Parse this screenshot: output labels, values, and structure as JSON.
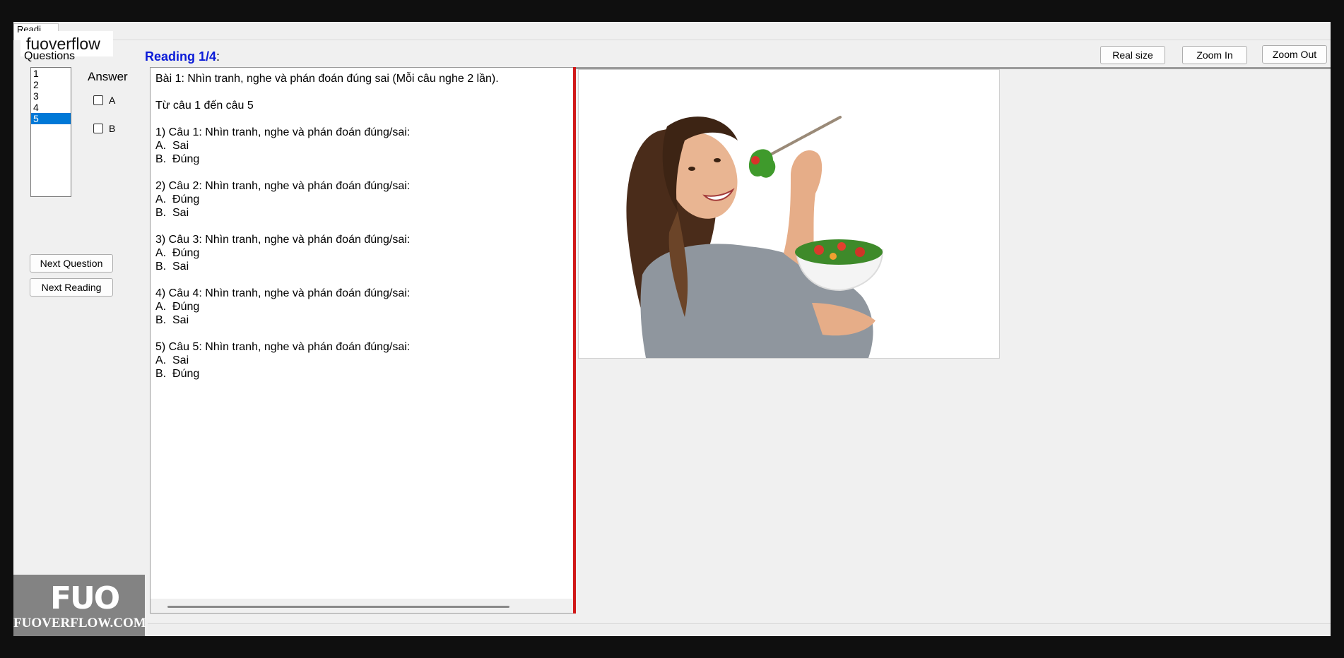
{
  "watermark": {
    "top_text": "fuoverflow",
    "logo_mark": "FUO",
    "logo_site": "FUOVERFLOW.COM"
  },
  "tab": {
    "label": "Readi..."
  },
  "sidebar": {
    "questions_label": "Questions",
    "question_items": [
      "1",
      "2",
      "3",
      "4",
      "5"
    ],
    "selected_question": "5",
    "answer_label": "Answer",
    "answer_options": [
      "A",
      "B"
    ],
    "next_question_label": "Next Question",
    "next_reading_label": "Next Reading"
  },
  "reading": {
    "title": "Reading 1/4",
    "title_suffix": ":",
    "text_lines": [
      "Bài 1: Nhìn tranh, nghe và phán đoán đúng sai (Mỗi câu nghe 2 lần).",
      "",
      "Từ câu 1 đến câu 5",
      "",
      "1) Câu 1: Nhìn tranh, nghe và phán đoán đúng/sai:",
      "A.  Sai",
      "B.  Đúng",
      "",
      "2) Câu 2: Nhìn tranh, nghe và phán đoán đúng/sai:",
      "A.  Đúng",
      "B.  Sai",
      "",
      "3) Câu 3: Nhìn tranh, nghe và phán đoán đúng/sai:",
      "A.  Đúng",
      "B.  Sai",
      "",
      "4) Câu 4: Nhìn tranh, nghe và phán đoán đúng/sai:",
      "A.  Đúng",
      "B.  Sai",
      "",
      "5) Câu 5: Nhìn tranh, nghe và phán đoán đúng/sai:",
      "A.  Sai",
      "B.  Đúng"
    ]
  },
  "toolbar": {
    "real_size_label": "Real size",
    "zoom_in_label": "Zoom In",
    "zoom_out_label": "Zoom Out"
  },
  "colors": {
    "title_blue": "#0a1bd8",
    "divider_red": "#d01818",
    "selection_blue": "#0078d7"
  },
  "image": {
    "subject": "woman eating salad with a fork holding a white bowl"
  }
}
